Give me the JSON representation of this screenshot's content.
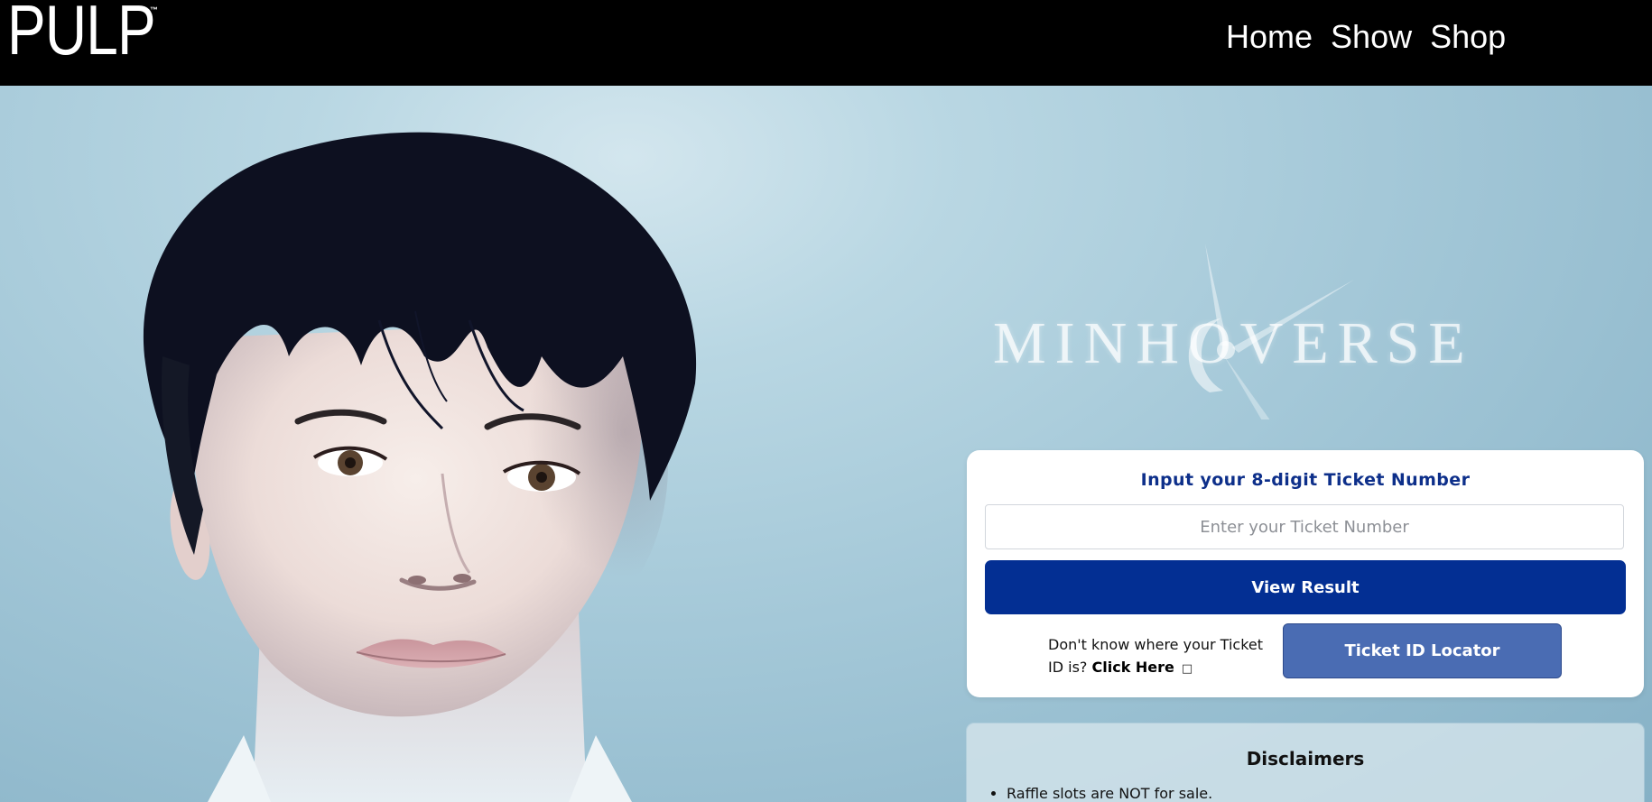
{
  "header": {
    "logo": "PULP",
    "logo_tm": "™",
    "nav": [
      {
        "label": "Home"
      },
      {
        "label": "Show"
      },
      {
        "label": "Shop"
      }
    ]
  },
  "hero": {
    "brand": "MINHOVERSE"
  },
  "ticket_form": {
    "title": "Input your 8-digit Ticket Number",
    "input_placeholder": "Enter your Ticket Number",
    "input_value": "",
    "submit_label": "View Result",
    "help_prefix": "Don't know where your Ticket ID is?",
    "help_link": "Click Here",
    "help_icon": "□",
    "locator_label": "Ticket ID Locator"
  },
  "disclaimers": {
    "title": "Disclaimers",
    "items": [
      "Raffle slots are NOT for sale."
    ]
  },
  "colors": {
    "nav_bg": "#000000",
    "primary_button": "#032f93",
    "secondary_button": "#4a6cb3",
    "title_blue": "#0d2f8a"
  }
}
